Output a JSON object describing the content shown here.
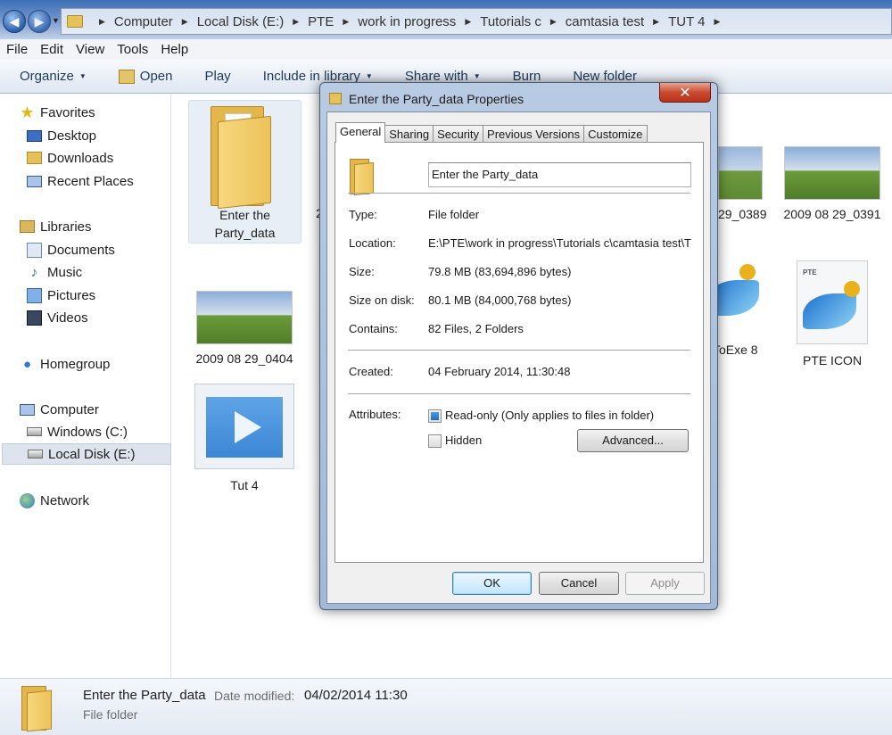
{
  "address": {
    "crumbs": [
      "Computer",
      "Local Disk (E:)",
      "PTE",
      "work in progress",
      "Tutorials c",
      "camtasia test",
      "TUT 4"
    ]
  },
  "menu": [
    "File",
    "Edit",
    "View",
    "Tools",
    "Help"
  ],
  "toolbar": {
    "organize": "Organize",
    "open": "Open",
    "play": "Play",
    "include": "Include in library",
    "share": "Share with",
    "burn": "Burn",
    "new_folder": "New folder"
  },
  "nav": {
    "favorites": "Favorites",
    "desktop": "Desktop",
    "downloads": "Downloads",
    "recent": "Recent Places",
    "libraries": "Libraries",
    "documents": "Documents",
    "music": "Music",
    "pictures": "Pictures",
    "videos": "Videos",
    "homegroup": "Homegroup",
    "computer": "Computer",
    "windows_c": "Windows (C:)",
    "local_e": "Local Disk (E:)",
    "network": "Network"
  },
  "files": {
    "folder_line1": "Enter the",
    "folder_line2": "Party_data",
    "partial_2": "2",
    "photo_0404": "2009 08 29_0404",
    "tut4": "Tut 4",
    "photo_0389_partial": "29_0389",
    "photo_0391": "2009 08 29_0391",
    "toexe_partial": "ToExe 8",
    "pte_icon": "PTE ICON",
    "pte_small": "PTE"
  },
  "details": {
    "name": "Enter the Party_data",
    "modified_label": "Date modified:",
    "modified_value": "04/02/2014 11:30",
    "type": "File folder"
  },
  "dialog": {
    "title": "Enter the Party_data Properties",
    "close": "✕",
    "tabs": [
      "General",
      "Sharing",
      "Security",
      "Previous Versions",
      "Customize"
    ],
    "name_value": "Enter the Party_data",
    "type_label": "Type:",
    "type_value": "File folder",
    "location_label": "Location:",
    "location_value": "E:\\PTE\\work in progress\\Tutorials c\\camtasia test\\TUT",
    "size_label": "Size:",
    "size_value": "79.8 MB (83,694,896 bytes)",
    "size_disk_label": "Size on disk:",
    "size_disk_value": "80.1 MB (84,000,768 bytes)",
    "contains_label": "Contains:",
    "contains_value": "82 Files, 2 Folders",
    "created_label": "Created:",
    "created_value": "04 February 2014, 11:30:48",
    "attributes_label": "Attributes:",
    "readonly_label": "Read-only (Only applies to files in folder)",
    "hidden_label": "Hidden",
    "advanced_button": "Advanced...",
    "ok_button": "OK",
    "cancel_button": "Cancel",
    "apply_button": "Apply"
  }
}
